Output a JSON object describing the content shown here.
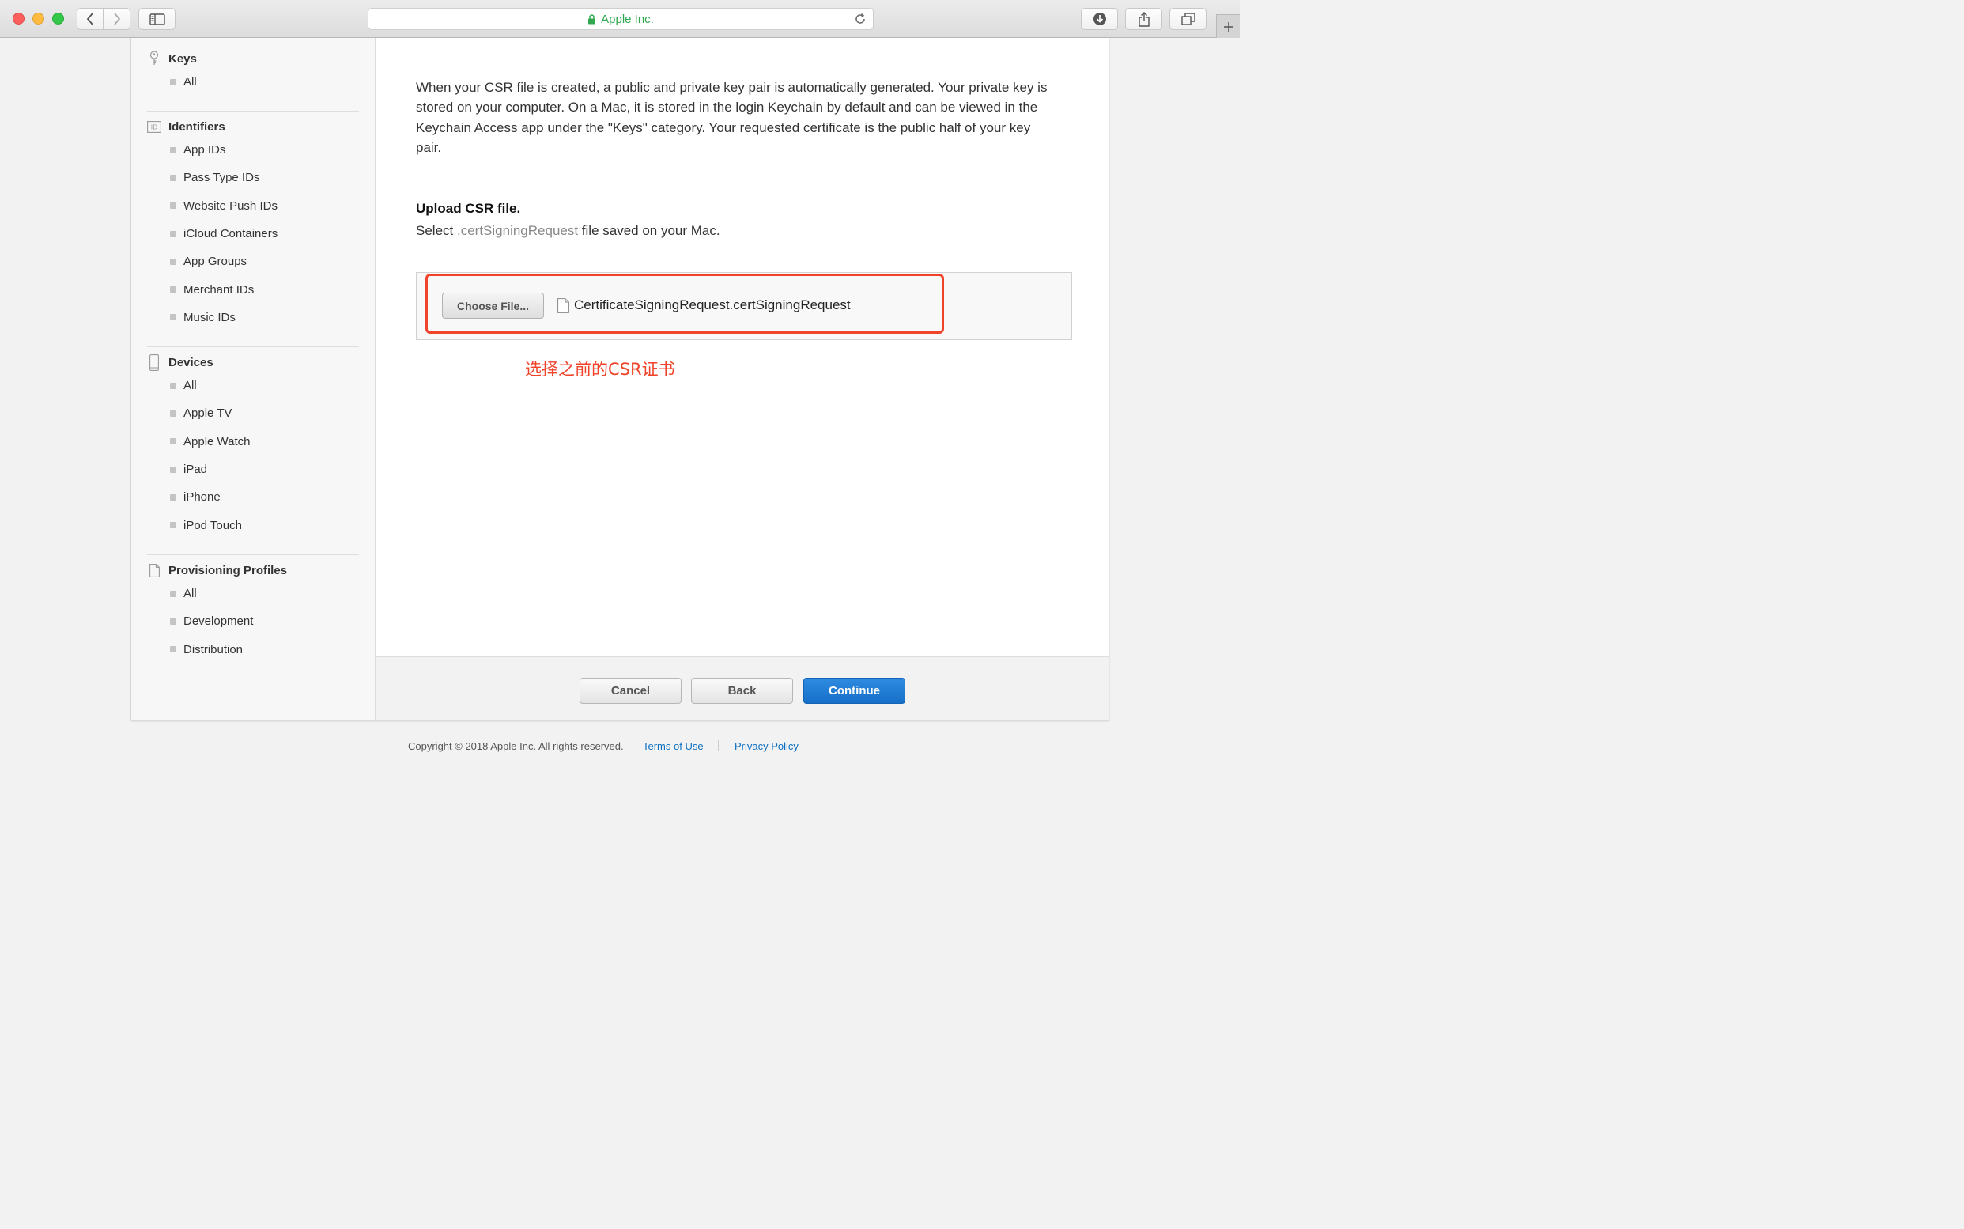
{
  "browser": {
    "url_title": "Apple Inc."
  },
  "sidebar": {
    "sections": [
      {
        "title": "Keys",
        "icon": "key-icon",
        "items": [
          "All"
        ]
      },
      {
        "title": "Identifiers",
        "icon": "id-icon",
        "items": [
          "App IDs",
          "Pass Type IDs",
          "Website Push IDs",
          "iCloud Containers",
          "App Groups",
          "Merchant IDs",
          "Music IDs"
        ]
      },
      {
        "title": "Devices",
        "icon": "device-icon",
        "items": [
          "All",
          "Apple TV",
          "Apple Watch",
          "iPad",
          "iPhone",
          "iPod Touch"
        ]
      },
      {
        "title": "Provisioning Profiles",
        "icon": "document-icon",
        "items": [
          "All",
          "Development",
          "Distribution"
        ]
      }
    ]
  },
  "main": {
    "intro": "When your CSR file is created, a public and private key pair is automatically generated. Your private key is stored on your computer. On a Mac, it is stored in the login Keychain by default and can be viewed in the Keychain Access app under the \"Keys\" category. Your requested certificate is the public half of your key pair.",
    "upload_title": "Upload CSR file.",
    "upload_sub_prefix": "Select ",
    "upload_sub_ext": ".certSigningRequest",
    "upload_sub_suffix": " file saved on your Mac.",
    "choose_file_label": "Choose File...",
    "file_name": "CertificateSigningRequest.certSigningRequest",
    "annotation": "选择之前的CSR证书"
  },
  "actions": {
    "cancel": "Cancel",
    "back": "Back",
    "continue": "Continue"
  },
  "footer": {
    "copyright": "Copyright © 2018 Apple Inc. All rights reserved.",
    "terms": "Terms of Use",
    "privacy": "Privacy Policy"
  },
  "colors": {
    "accent": "#1a73cc",
    "annotation": "#f0432a",
    "secure": "#2fa84f"
  }
}
